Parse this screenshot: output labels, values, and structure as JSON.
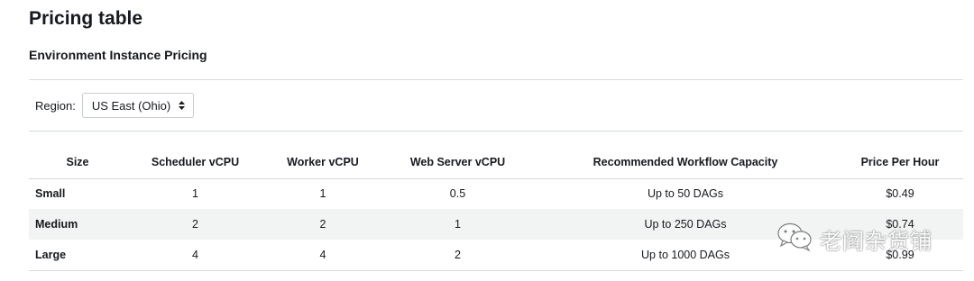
{
  "page": {
    "title": "Pricing table",
    "section_title": "Environment Instance Pricing"
  },
  "region": {
    "label": "Region:",
    "selected": "US East (Ohio)"
  },
  "table": {
    "columns": [
      "Size",
      "Scheduler vCPU",
      "Worker vCPU",
      "Web Server vCPU",
      "Recommended Workflow Capacity",
      "Price Per Hour"
    ],
    "rows": [
      [
        "Small",
        "1",
        "1",
        "0.5",
        "Up to 50 DAGs",
        "$0.49"
      ],
      [
        "Medium",
        "2",
        "2",
        "1",
        "Up to 250 DAGs",
        "$0.74"
      ],
      [
        "Large",
        "4",
        "4",
        "2",
        "Up to 1000 DAGs",
        "$0.99"
      ]
    ]
  },
  "watermark": {
    "icon": "wechat-icon",
    "text": "老阎杂货铺"
  },
  "colors": {
    "text": "#16191f",
    "divider": "#d5dbdb",
    "stripe": "#f2f3f3"
  }
}
